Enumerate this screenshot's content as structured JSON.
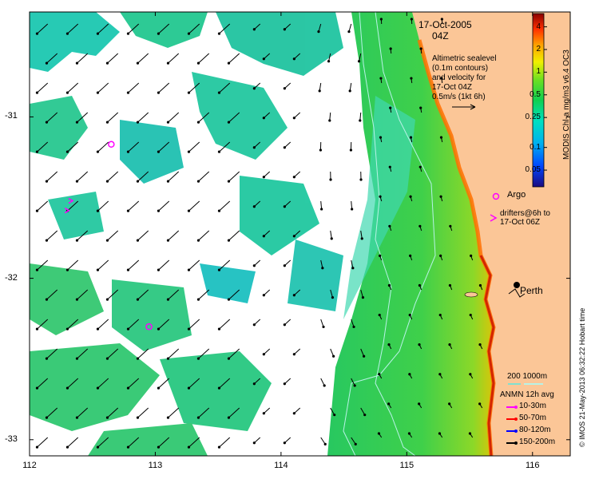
{
  "header": {
    "date": "17-Oct-2005",
    "time": "04Z"
  },
  "altimetry_note": {
    "lines": [
      "Altimetric sealevel",
      "(0.1m contours)",
      "and velocity for",
      "17-Oct 04Z",
      "0.5m/s (1kt 6h)"
    ]
  },
  "colorbar": {
    "title": "MODIS Chl-a mg/m3 v6.4 OC3",
    "ticks": [
      "4",
      "2",
      "1",
      "0.5",
      "0.25",
      "0.1",
      "0.05"
    ],
    "tick_values": [
      4,
      2,
      1,
      0.5,
      0.25,
      0.1,
      0.05
    ],
    "range": [
      0.03,
      6
    ]
  },
  "axes": {
    "x_ticks": [
      "112",
      "113",
      "114",
      "115",
      "116"
    ],
    "x_values": [
      112,
      113,
      114,
      115,
      116
    ],
    "y_ticks": [
      "-31",
      "-32",
      "-33"
    ],
    "y_values": [
      -31,
      -32,
      -33
    ],
    "lon_range": [
      112,
      116.3
    ],
    "lat_range": [
      -30.35,
      -33.1
    ]
  },
  "legend": {
    "argo_label": "Argo",
    "drifter_label_1": "drifters@6h to",
    "drifter_label_2": "17-Oct 06Z",
    "isobath_label": "200  1000m",
    "anmn_title": "ANMN 12h avg",
    "anmn_items": [
      {
        "label": "10-30m",
        "color": "#ff00ff"
      },
      {
        "label": "50-70m",
        "color": "#ff0000"
      },
      {
        "label": "80-120m",
        "color": "#0000ff"
      },
      {
        "label": "150-200m",
        "color": "#000000"
      }
    ]
  },
  "places": {
    "city": "Perth"
  },
  "credit": "© IMOS 21-May-2013 06:32:22 Hobart time",
  "colors": {
    "land": "#fbc697",
    "ocean_nodata": "#ffffff",
    "argo": "#ff00ff",
    "isobath": "#b7f2e6"
  },
  "argo_floats": [
    {
      "lon": 112.65,
      "lat": -31.17
    },
    {
      "lon": 112.95,
      "lat": -32.3
    }
  ],
  "drifters": [
    {
      "lon": 112.33,
      "lat": -31.52
    },
    {
      "lon": 112.3,
      "lat": -31.58
    }
  ]
}
